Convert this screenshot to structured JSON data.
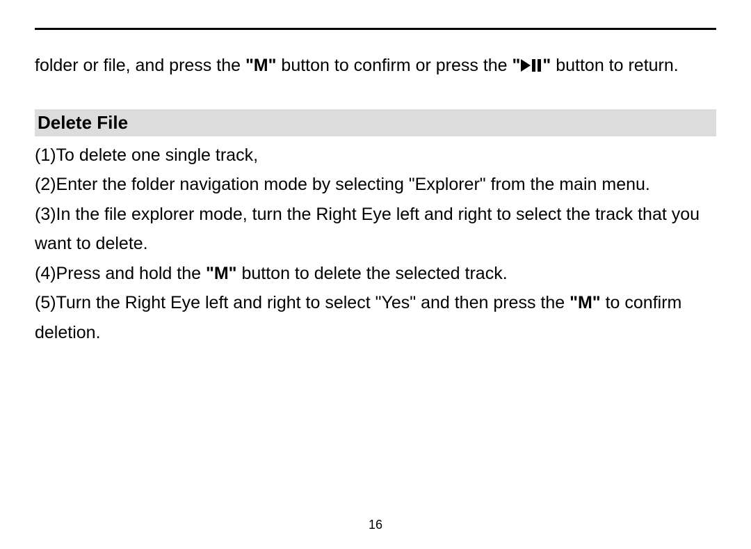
{
  "intro": {
    "part1": "folder or file, and press the ",
    "m1": "\"M\"",
    "part2": " button to confirm or press the ",
    "quoteOpen": "\"",
    "quoteClose": "\"",
    "part3": " button to return."
  },
  "sectionHeading": "Delete File",
  "items": {
    "i1": "(1)To delete one single track,",
    "i2": "(2)Enter the folder navigation mode by selecting \"Explorer\" from the main menu.",
    "i3": "(3)In the file explorer mode, turn the Right Eye left and right to select the track that you want to delete.",
    "i4a": "(4)Press and hold the ",
    "i4b": "\"M\"",
    "i4c": " button to delete the selected track.",
    "i5a": "(5)Turn the Right Eye left and right to select \"Yes\" and then press the ",
    "i5b": "\"M\"",
    "i5c": " to confirm deletion."
  },
  "pageNumber": "16",
  "icons": {
    "playPause": "play-pause-icon"
  }
}
